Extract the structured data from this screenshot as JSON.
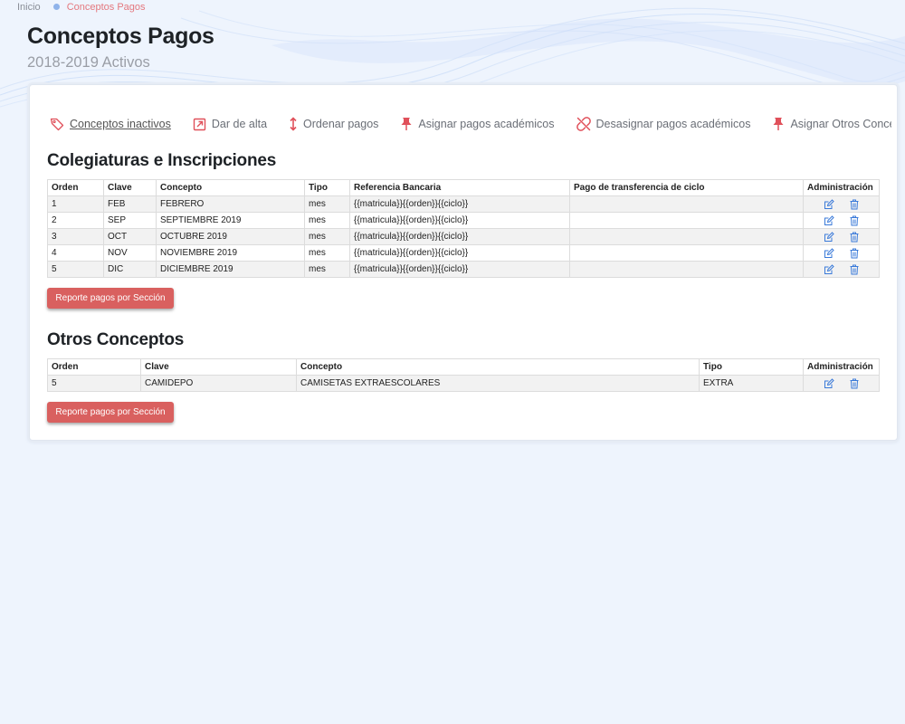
{
  "breadcrumb": {
    "home": "Inicio",
    "current": "Conceptos Pagos"
  },
  "page": {
    "title": "Conceptos Pagos",
    "subtitle": "2018-2019 Activos"
  },
  "colors": {
    "accent": "#d9605f",
    "icon_red": "#e0505a",
    "icon_blue": "#3a7ad9",
    "breadcrumb_dot": "#8fb3ea"
  },
  "toolbar": [
    {
      "label": "Conceptos inactivos",
      "icon": "tag-icon"
    },
    {
      "label": "Dar de alta",
      "icon": "external-link-icon"
    },
    {
      "label": "Ordenar pagos",
      "icon": "sort-vertical-icon"
    },
    {
      "label": "Asignar pagos académicos",
      "icon": "pin-icon"
    },
    {
      "label": "Desasignar pagos académicos",
      "icon": "unlink-icon"
    },
    {
      "label": "Asignar Otros Conceptos",
      "icon": "pin-icon"
    }
  ],
  "colegiaturas": {
    "title": "Colegiaturas e Inscripciones",
    "columns": [
      "Orden",
      "Clave",
      "Concepto",
      "Tipo",
      "Referencia Bancaria",
      "Pago de transferencia de ciclo",
      "Administración"
    ],
    "rows": [
      [
        "1",
        "FEB",
        "FEBRERO",
        "mes",
        "{{matricula}}{{orden}}{{ciclo}}",
        ""
      ],
      [
        "2",
        "SEP",
        "SEPTIEMBRE 2019",
        "mes",
        "{{matricula}}{{orden}}{{ciclo}}",
        ""
      ],
      [
        "3",
        "OCT",
        "OCTUBRE 2019",
        "mes",
        "{{matricula}}{{orden}}{{ciclo}}",
        ""
      ],
      [
        "4",
        "NOV",
        "NOVIEMBRE 2019",
        "mes",
        "{{matricula}}{{orden}}{{ciclo}}",
        ""
      ],
      [
        "5",
        "DIC",
        "DICIEMBRE 2019",
        "mes",
        "{{matricula}}{{orden}}{{ciclo}}",
        ""
      ]
    ],
    "report_button": "Reporte pagos por Sección"
  },
  "otros": {
    "title": "Otros Conceptos",
    "columns": [
      "Orden",
      "Clave",
      "Concepto",
      "Tipo",
      "Administración"
    ],
    "rows": [
      [
        "5",
        "CAMIDEPO",
        "CAMISETAS EXTRAESCOLARES",
        "EXTRA"
      ]
    ],
    "report_button": "Reporte pagos por Sección"
  }
}
